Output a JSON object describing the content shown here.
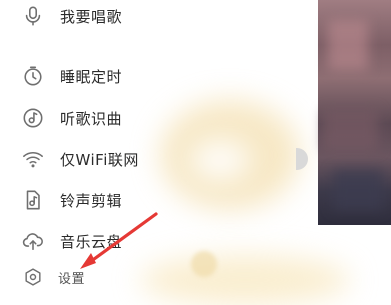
{
  "menu": {
    "items": [
      {
        "label": "我要唱歌",
        "icon": "microphone-icon"
      },
      {
        "label": "睡眠定时",
        "icon": "timer-icon"
      },
      {
        "label": "听歌识曲",
        "icon": "music-note-icon"
      },
      {
        "label": "仅WiFi联网",
        "icon": "wifi-icon"
      },
      {
        "label": "铃声剪辑",
        "icon": "ringtone-icon"
      },
      {
        "label": "音乐云盘",
        "icon": "cloud-icon"
      }
    ],
    "settings": {
      "label": "设置",
      "icon": "settings-icon"
    }
  },
  "annotation": {
    "color": "#e53935"
  }
}
